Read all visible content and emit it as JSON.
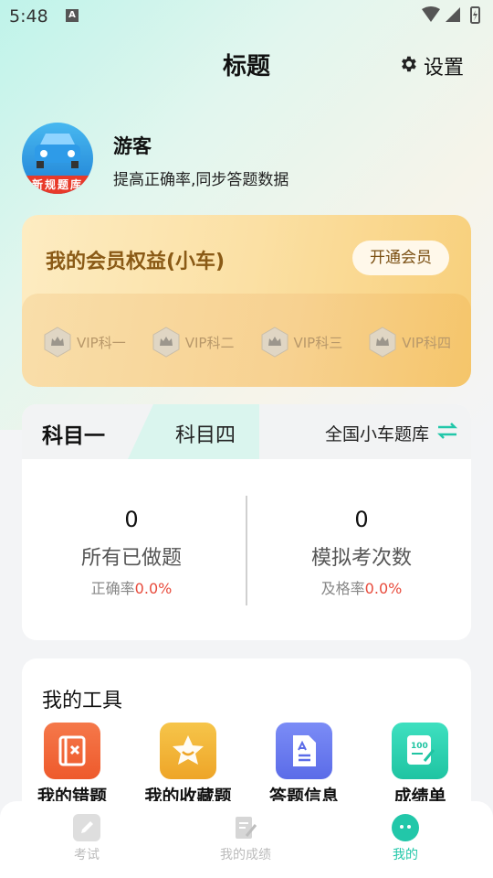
{
  "status_bar": {
    "time": "5:48",
    "notification": "A"
  },
  "header": {
    "title": "标题",
    "settings_label": "设置"
  },
  "profile": {
    "avatar_text": "新规题库",
    "name": "游客",
    "subtitle": "提高正确率,同步答题数据"
  },
  "vip": {
    "title": "我的会员权益(小车)",
    "button": "开通会员",
    "items": [
      {
        "label": "VIP科一"
      },
      {
        "label": "VIP科二"
      },
      {
        "label": "VIP科三"
      },
      {
        "label": "VIP科四"
      }
    ]
  },
  "subjects": {
    "tab1": "科目一",
    "tab2": "科目四",
    "bank": "全国小车题库",
    "stats": [
      {
        "value": "0",
        "title": "所有已做题",
        "sub_label": "正确率",
        "sub_value": "0.0%"
      },
      {
        "value": "0",
        "title": "模拟考次数",
        "sub_label": "及格率",
        "sub_value": "0.0%"
      }
    ]
  },
  "tools": {
    "title": "我的工具",
    "items": [
      {
        "label": "我的错题",
        "icon": "wrong-book-icon",
        "color": "#f06a3a"
      },
      {
        "label": "我的收藏题",
        "icon": "star-icon",
        "color": "#f2b536"
      },
      {
        "label": "答题信息",
        "icon": "document-icon",
        "color": "#6b7cf0"
      },
      {
        "label": "成绩单",
        "icon": "score-icon",
        "color": "#2fd6b4"
      }
    ]
  },
  "bottom_nav": {
    "items": [
      {
        "label": "考试",
        "icon": "pencil-icon",
        "active": false
      },
      {
        "label": "我的成绩",
        "icon": "edit-doc-icon",
        "active": false
      },
      {
        "label": "我的",
        "icon": "mascot-icon",
        "active": true
      }
    ]
  },
  "colors": {
    "accent": "#22c7a9",
    "rate": "#e84b3c",
    "vip_text": "#8a5a16"
  }
}
